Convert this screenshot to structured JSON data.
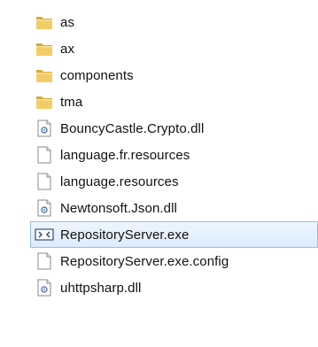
{
  "files": [
    {
      "name": "as",
      "icon": "folder-icon"
    },
    {
      "name": "ax",
      "icon": "folder-icon"
    },
    {
      "name": "components",
      "icon": "folder-icon"
    },
    {
      "name": "tma",
      "icon": "folder-icon"
    },
    {
      "name": "BouncyCastle.Crypto.dll",
      "icon": "dll-file-icon"
    },
    {
      "name": "language.fr.resources",
      "icon": "file-icon"
    },
    {
      "name": "language.resources",
      "icon": "file-icon"
    },
    {
      "name": "Newtonsoft.Json.dll",
      "icon": "dll-file-icon"
    },
    {
      "name": "RepositoryServer.exe",
      "icon": "exe-file-icon",
      "selected": true
    },
    {
      "name": "RepositoryServer.exe.config",
      "icon": "file-icon"
    },
    {
      "name": "uhttpsharp.dll",
      "icon": "dll-file-icon"
    }
  ],
  "colors": {
    "folder": "#e8c35a",
    "selection_bg": "#dcecfc",
    "selection_border": "#8fc1ef"
  }
}
